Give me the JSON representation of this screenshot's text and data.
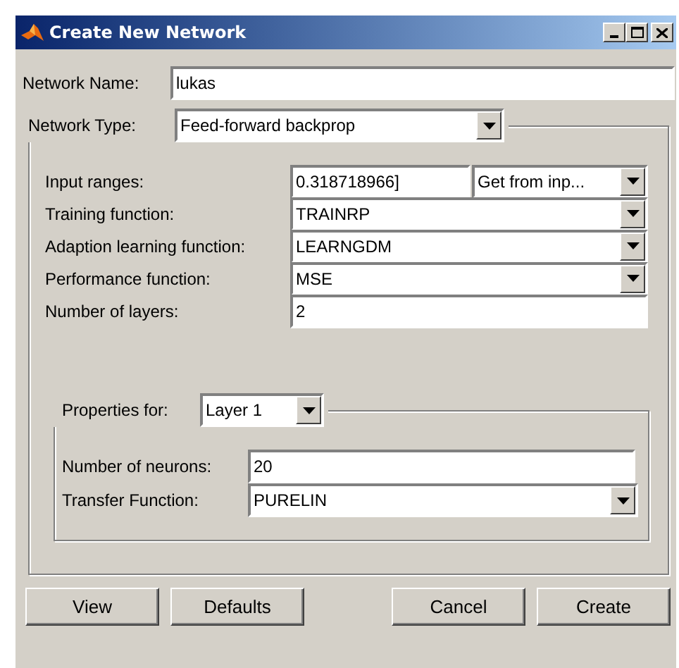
{
  "window": {
    "title": "Create New Network"
  },
  "network_name": {
    "label": "Network Name:",
    "value": "lukas"
  },
  "network_type": {
    "label": "Network Type:",
    "value": "Feed-forward backprop"
  },
  "fields": [
    {
      "kind": "range",
      "label": "Input ranges:",
      "value": "0.318718966]",
      "option": "Get from inp..."
    },
    {
      "kind": "dropdown",
      "label": "Training function:",
      "value": "TRAINRP"
    },
    {
      "kind": "dropdown",
      "label": "Adaption learning function:",
      "value": "LEARNGDM"
    },
    {
      "kind": "dropdown",
      "label": "Performance function:",
      "value": "MSE"
    },
    {
      "kind": "text",
      "label": "Number of layers:",
      "value": "2"
    }
  ],
  "properties": {
    "label": "Properties for:",
    "layer": "Layer 1",
    "fields": [
      {
        "kind": "text",
        "label": "Number of neurons:",
        "value": "20"
      },
      {
        "kind": "dropdown",
        "label": "Transfer Function:",
        "value": "PURELIN"
      }
    ]
  },
  "left_buttons": [
    "View",
    "Defaults"
  ],
  "right_buttons": [
    "Cancel",
    "Create"
  ]
}
